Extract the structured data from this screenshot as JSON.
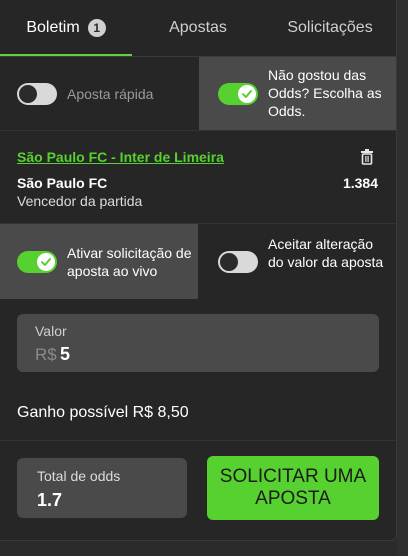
{
  "tabs": [
    {
      "label": "Boletim",
      "badge": "1",
      "active": true
    },
    {
      "label": "Apostas",
      "active": false
    },
    {
      "label": "Solicitações",
      "active": false
    }
  ],
  "toggles": {
    "quick_bet": {
      "label": "Aposta rápida",
      "on": false
    },
    "choose_odds": {
      "label": "Não gostou das Odds? Escolha as Odds.",
      "on": true
    },
    "live_request": {
      "label": "Ativar solicitação de aposta ao vivo",
      "on": true
    },
    "accept_change": {
      "label": "Aceitar alteração do valor da aposta",
      "on": false
    }
  },
  "match": {
    "title": "São Paulo FC - Inter de Limeira",
    "selection": "São Paulo FC",
    "odds": "1.384",
    "market": "Vencedor da partida"
  },
  "stake": {
    "label": "Valor",
    "currency": "R$",
    "amount": "5"
  },
  "potential_win": "Ganho possível R$ 8,50",
  "total_odds": {
    "label": "Total de odds",
    "value": "1.7"
  },
  "cta_label": "SOLICITAR UMA APOSTA",
  "colors": {
    "accent": "#57d12f",
    "panel": "#262626",
    "cell_highlight": "#4a4a4a"
  },
  "icons": {
    "trash": "trash-icon",
    "check": "check-icon"
  }
}
